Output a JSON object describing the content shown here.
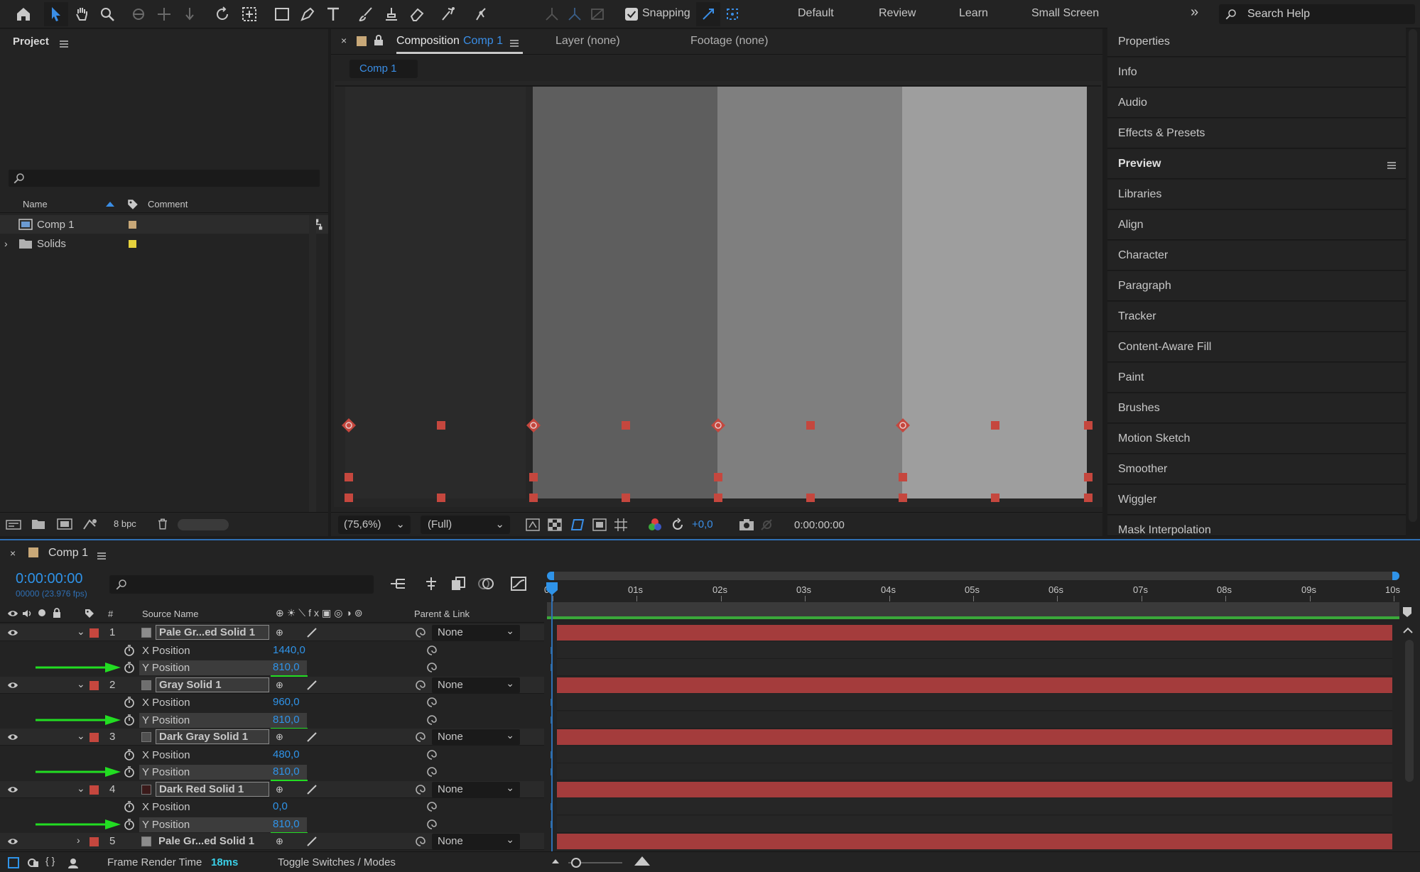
{
  "toolbar": {
    "snapping_label": "Snapping",
    "workspaces": [
      "Default",
      "Review",
      "Learn",
      "Small Screen"
    ],
    "search_placeholder": "Search Help"
  },
  "project": {
    "title": "Project",
    "columns": {
      "name": "Name",
      "comment": "Comment"
    },
    "items": [
      {
        "name": "Comp 1",
        "color": "#c8a878"
      },
      {
        "name": "Solids",
        "color": "#e6d23c"
      }
    ],
    "bpc": "8 bpc"
  },
  "composition": {
    "tab_prefix": "Composition",
    "tab_name": "Comp 1",
    "layer_tab": "Layer (none)",
    "footage_tab": "Footage (none)",
    "subtab": "Comp 1",
    "zoom": "(75,6%)",
    "resolution": "(Full)",
    "exposure": "+0,0",
    "timecode": "0:00:00:00",
    "columns": [
      "#5e5e5e",
      "#7f7f7f",
      "#9e9e9e"
    ]
  },
  "right_panel": {
    "items": [
      "Properties",
      "Info",
      "Audio",
      "Effects & Presets",
      "Preview",
      "Libraries",
      "Align",
      "Character",
      "Paragraph",
      "Tracker",
      "Content-Aware Fill",
      "Paint",
      "Brushes",
      "Motion Sketch",
      "Smoother",
      "Wiggler",
      "Mask Interpolation"
    ]
  },
  "timeline": {
    "tab": "Comp 1",
    "timecode": "0:00:00:00",
    "fps": "00000 (23.976 fps)",
    "col_source": "Source Name",
    "col_parent": "Parent & Link",
    "col_num": "#",
    "ruler": [
      "0s",
      "01s",
      "02s",
      "03s",
      "04s",
      "05s",
      "06s",
      "07s",
      "08s",
      "09s",
      "10s"
    ],
    "layers": [
      {
        "num": "1",
        "name": "Pale Gr...ed Solid 1",
        "color": "#8c8c8c",
        "parent": "None",
        "x": "1440,0",
        "y": "810,0"
      },
      {
        "num": "2",
        "name": "Gray Solid 1",
        "color": "#6f6f6f",
        "parent": "None",
        "x": "960,0",
        "y": "810,0"
      },
      {
        "num": "3",
        "name": "Dark Gray Solid 1",
        "color": "#505050",
        "parent": "None",
        "x": "480,0",
        "y": "810,0"
      },
      {
        "num": "4",
        "name": "Dark Red Solid 1",
        "color": "#3a1a1a",
        "parent": "None",
        "x": "0,0",
        "y": "810,0"
      },
      {
        "num": "5",
        "name": "Pale Gr...ed Solid 1",
        "color": "#8c8c8c",
        "parent": "None"
      }
    ],
    "x_label": "X Position",
    "y_label": "Y Position",
    "frame_render_label": "Frame Render Time",
    "frame_render_value": "18ms",
    "toggle_label": "Toggle Switches / Modes"
  },
  "colors": {
    "accent": "#2f93e8",
    "label_red": "#c5473e",
    "arrow_green": "#22dd22"
  }
}
